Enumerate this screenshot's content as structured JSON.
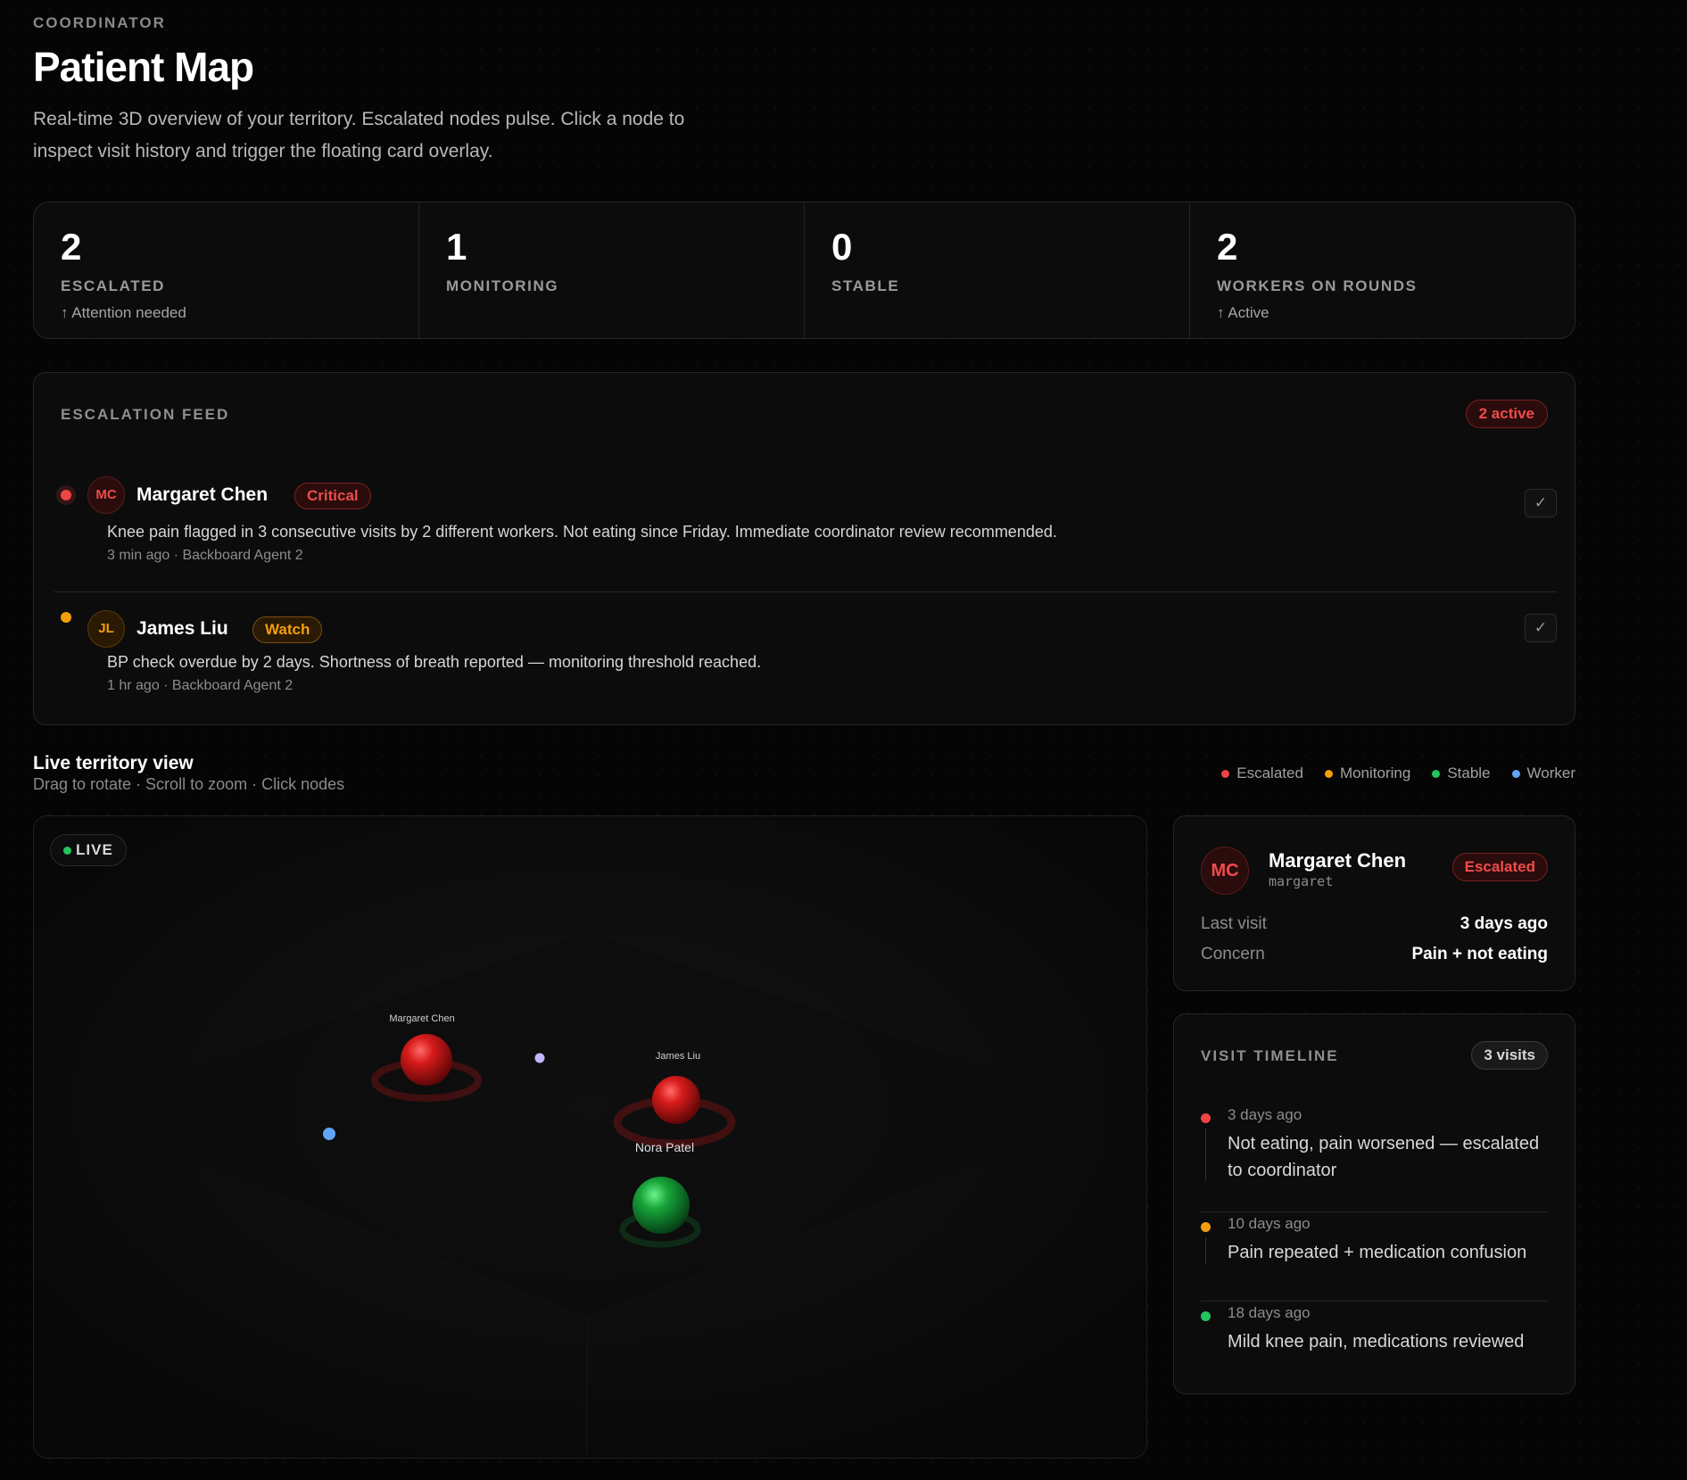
{
  "header": {
    "eyebrow": "COORDINATOR",
    "title": "Patient Map",
    "subtitle": "Real-time 3D overview of your territory. Escalated nodes pulse. Click a node to inspect visit history and trigger the floating card overlay."
  },
  "stats": [
    {
      "value": "2",
      "label": "ESCALATED",
      "sub": "↑ Attention needed"
    },
    {
      "value": "1",
      "label": "MONITORING",
      "sub": ""
    },
    {
      "value": "0",
      "label": "STABLE",
      "sub": ""
    },
    {
      "value": "2",
      "label": "WORKERS ON ROUNDS",
      "sub": "↑ Active"
    }
  ],
  "feed": {
    "title": "ESCALATION FEED",
    "active_badge": "2 active",
    "items": [
      {
        "initials": "MC",
        "name": "Margaret Chen",
        "tag": "Critical",
        "text": "Knee pain flagged in 3 consecutive visits by 2 different workers. Not eating since Friday. Immediate coordinator review recommended.",
        "meta": "3 min ago · Backboard Agent 2",
        "check": "✓"
      },
      {
        "initials": "JL",
        "name": "James Liu",
        "tag": "Watch",
        "text": "BP check overdue by 2 days. Shortness of breath reported — monitoring threshold reached.",
        "meta": "1 hr ago · Backboard Agent 2",
        "check": "✓"
      }
    ]
  },
  "live_view": {
    "title": "Live territory view",
    "subtitle": "Drag to rotate · Scroll to zoom · Click nodes",
    "badge": "LIVE",
    "legend": [
      {
        "label": "Escalated",
        "color": "#ef4444"
      },
      {
        "label": "Monitoring",
        "color": "#f59e0b"
      },
      {
        "label": "Stable",
        "color": "#22c55e"
      },
      {
        "label": "Worker",
        "color": "#60a5fa"
      }
    ],
    "node_labels": {
      "margaret": "Margaret Chen",
      "james": "James Liu",
      "nora": "Nora Patel"
    }
  },
  "patient_card": {
    "initials": "MC",
    "name": "Margaret Chen",
    "id": "margaret",
    "status": "Escalated",
    "rows": [
      {
        "key": "Last visit",
        "value": "3 days ago"
      },
      {
        "key": "Concern",
        "value": "Pain + not eating"
      }
    ]
  },
  "timeline": {
    "title": "VISIT TIMELINE",
    "badge": "3 visits",
    "entries": [
      {
        "when": "3 days ago",
        "what": "Not eating, pain worsened — escalated to coordinator",
        "color": "#ef4444"
      },
      {
        "when": "10 days ago",
        "what": "Pain repeated + medication confusion",
        "color": "#f59e0b"
      },
      {
        "when": "18 days ago",
        "what": "Mild knee pain, medications reviewed",
        "color": "#22c55e"
      }
    ]
  }
}
